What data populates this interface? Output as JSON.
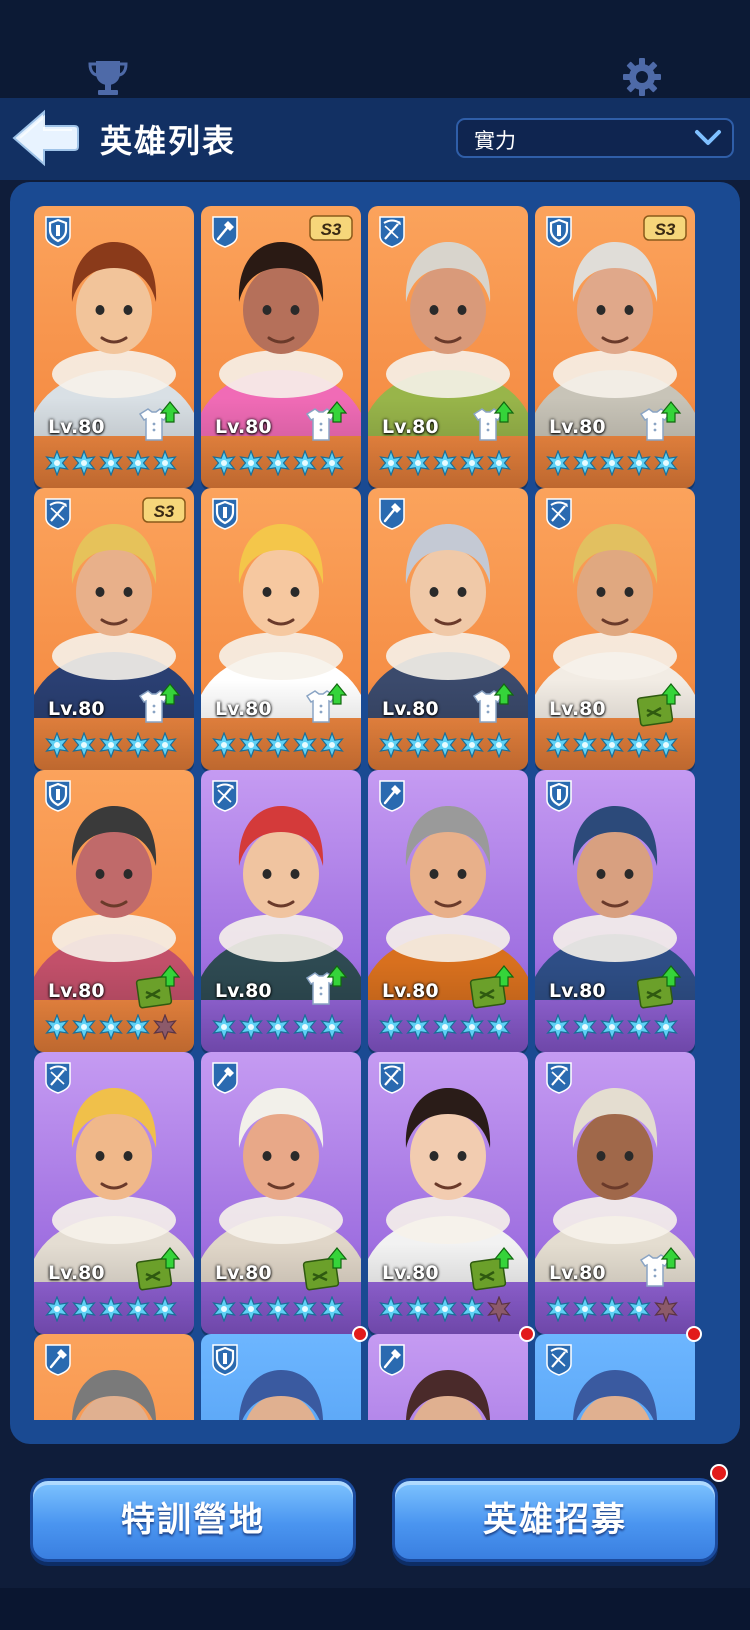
{
  "header": {
    "title": "英雄列表",
    "sort": {
      "selected": "實力"
    }
  },
  "cards": [
    {
      "role": "shield",
      "bg": "orange",
      "level": "Lv.80",
      "season": "",
      "upgrade": "shirt",
      "stars": 5,
      "hair": "#8a3a1a",
      "skin": "#f2c49a",
      "cloth": "#d9e0e5"
    },
    {
      "role": "shovel",
      "bg": "orange",
      "level": "Lv.80",
      "season": "S3",
      "upgrade": "shirt",
      "stars": 5,
      "hair": "#2a1a14",
      "skin": "#b5705a",
      "cloth": "#f06bb6"
    },
    {
      "role": "crossbow",
      "bg": "orange",
      "level": "Lv.80",
      "season": "",
      "upgrade": "shirt",
      "stars": 5,
      "hair": "#d8d4cc",
      "skin": "#d99a7a",
      "cloth": "#98b54a"
    },
    {
      "role": "shield",
      "bg": "orange",
      "level": "Lv.80",
      "season": "S3",
      "upgrade": "shirt",
      "stars": 5,
      "hair": "#e0ddd8",
      "skin": "#e0a88a",
      "cloth": "#c8c4b8"
    },
    {
      "role": "crossbow",
      "bg": "orange",
      "level": "Lv.80",
      "season": "S3",
      "upgrade": "shirt",
      "stars": 5,
      "hair": "#e6c25a",
      "skin": "#e8b08a",
      "cloth": "#2a3f72"
    },
    {
      "role": "shield",
      "bg": "orange",
      "level": "Lv.80",
      "season": "",
      "upgrade": "shirt",
      "stars": 5,
      "hair": "#f4c64a",
      "skin": "#f6c8a0",
      "cloth": "#ffffff"
    },
    {
      "role": "shovel",
      "bg": "orange",
      "level": "Lv.80",
      "season": "",
      "upgrade": "shirt",
      "stars": 5,
      "hair": "#c4c9d4",
      "skin": "#f0c9a8",
      "cloth": "#3b4a6c"
    },
    {
      "role": "crossbow",
      "bg": "orange",
      "level": "Lv.80",
      "season": "",
      "upgrade": "book",
      "stars": 5,
      "hair": "#e2c060",
      "skin": "#e0a880",
      "cloth": "#f2ece4"
    },
    {
      "role": "shield",
      "bg": "orange",
      "level": "Lv.80",
      "season": "",
      "upgrade": "book",
      "stars": 4,
      "hair": "#3a3a3a",
      "skin": "#c06a6a",
      "cloth": "#c2506a"
    },
    {
      "role": "crossbow",
      "bg": "purple",
      "level": "Lv.80",
      "season": "",
      "upgrade": "shirt",
      "stars": 5,
      "hair": "#d43a3a",
      "skin": "#f0c4a0",
      "cloth": "#2e4a52"
    },
    {
      "role": "shovel",
      "bg": "purple",
      "level": "Lv.80",
      "season": "",
      "upgrade": "book",
      "stars": 5,
      "hair": "#9a9a9a",
      "skin": "#e8b08a",
      "cloth": "#d8701e"
    },
    {
      "role": "shield",
      "bg": "purple",
      "level": "Lv.80",
      "season": "",
      "upgrade": "book",
      "stars": 5,
      "hair": "#2c4a7a",
      "skin": "#d8a080",
      "cloth": "#2e4e86"
    },
    {
      "role": "crossbow",
      "bg": "purple",
      "level": "Lv.80",
      "season": "",
      "upgrade": "book",
      "stars": 5,
      "hair": "#f0c04a",
      "skin": "#f0b88a",
      "cloth": "#e4ddd2"
    },
    {
      "role": "shovel",
      "bg": "purple",
      "level": "Lv.80",
      "season": "",
      "upgrade": "book",
      "stars": 5,
      "hair": "#f2f0ea",
      "skin": "#e8a888",
      "cloth": "#e0d6c8"
    },
    {
      "role": "crossbow",
      "bg": "purple",
      "level": "Lv.80",
      "season": "",
      "upgrade": "book",
      "stars": 4,
      "hair": "#2a1c18",
      "skin": "#f2ccb0",
      "cloth": "#f2f2f2"
    },
    {
      "role": "crossbow",
      "bg": "purple",
      "level": "Lv.80",
      "season": "",
      "upgrade": "shirt",
      "stars": 4,
      "hair": "#e4ddd0",
      "skin": "#a0684a",
      "cloth": "#e4ddd0"
    },
    {
      "role": "shovel",
      "bg": "orange",
      "level": "",
      "season": "",
      "upgrade": "",
      "stars": 0,
      "hair": "#7a7a7a",
      "skin": "#e0b090",
      "cloth": "#888888",
      "notify": false
    },
    {
      "role": "shield",
      "bg": "blue",
      "level": "",
      "season": "",
      "upgrade": "",
      "stars": 0,
      "hair": "#3a5aa0",
      "skin": "#e0b090",
      "cloth": "#4a7ac0",
      "notify": true
    },
    {
      "role": "shovel",
      "bg": "purple",
      "level": "",
      "season": "",
      "upgrade": "",
      "stars": 0,
      "hair": "#4a2a2a",
      "skin": "#e0b090",
      "cloth": "#7a5aa0",
      "notify": true
    },
    {
      "role": "crossbow",
      "bg": "blue",
      "level": "",
      "season": "",
      "upgrade": "",
      "stars": 0,
      "hair": "#3a5aa0",
      "skin": "#e0b090",
      "cloth": "#4a7ac0",
      "notify": true
    }
  ],
  "buttons": {
    "training_camp": "特訓營地",
    "hero_recruit": "英雄招募",
    "recruit_notify": true
  },
  "colors": {
    "star": "#5ed1f5",
    "star_empty": "#8c5a6a",
    "level_text": "#ffffff",
    "notify": "#e21b1b"
  }
}
